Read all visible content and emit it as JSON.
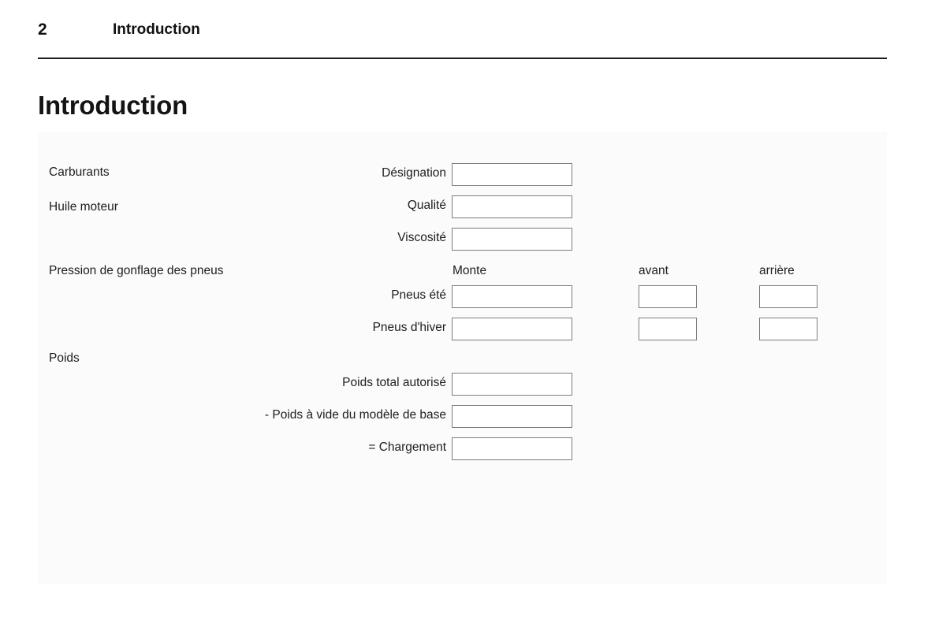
{
  "header": {
    "page_number": "2",
    "chapter": "Introduction"
  },
  "page_title": "Introduction",
  "form": {
    "sections": [
      {
        "label": "Carburants"
      },
      {
        "label": "Huile moteur"
      },
      {
        "label": "Pression de gonflage des pneus"
      },
      {
        "label": "Poids"
      }
    ],
    "column_headers": {
      "monte": "Monte",
      "avant": "avant",
      "arriere": "arrière"
    },
    "fields": [
      {
        "label": "Désignation",
        "value": ""
      },
      {
        "label": "Qualité",
        "value": ""
      },
      {
        "label": "Viscosité",
        "value": ""
      },
      {
        "label": "Pneus été",
        "value": "",
        "avant": "",
        "arriere": ""
      },
      {
        "label": "Pneus d'hiver",
        "value": "",
        "avant": "",
        "arriere": ""
      },
      {
        "label": "Poids total autorisé",
        "value": ""
      },
      {
        "label": "- Poids à vide du modèle de base",
        "value": ""
      },
      {
        "label": "= Chargement",
        "value": ""
      }
    ]
  },
  "colors": {
    "text": "#1d1d1d",
    "rule": "#1b1b1b",
    "box_border": "#7d7d7d",
    "panel_background": "#fbfbfb",
    "page_background": "#ffffff"
  }
}
